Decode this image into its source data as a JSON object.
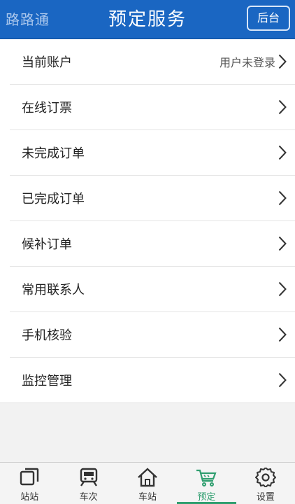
{
  "header": {
    "app_name": "路路通",
    "title": "预定服务",
    "back_label": "后台"
  },
  "menu": {
    "items": [
      {
        "label": "当前账户",
        "value": "用户未登录"
      },
      {
        "label": "在线订票",
        "value": ""
      },
      {
        "label": "未完成订单",
        "value": ""
      },
      {
        "label": "已完成订单",
        "value": ""
      },
      {
        "label": "候补订单",
        "value": ""
      },
      {
        "label": "常用联系人",
        "value": ""
      },
      {
        "label": "手机核验",
        "value": ""
      },
      {
        "label": "监控管理",
        "value": ""
      }
    ]
  },
  "tabbar": {
    "active": "预定",
    "accent_color": "#2f9e6f",
    "tabs": [
      {
        "label": "站站",
        "icon": "station-to-station-icon"
      },
      {
        "label": "车次",
        "icon": "train-icon"
      },
      {
        "label": "车站",
        "icon": "home-icon"
      },
      {
        "label": "预定",
        "icon": "cart-icon"
      },
      {
        "label": "设置",
        "icon": "gear-icon"
      }
    ]
  },
  "colors": {
    "header_bg": "#1a66c2",
    "page_bg": "#f2f2f2"
  }
}
